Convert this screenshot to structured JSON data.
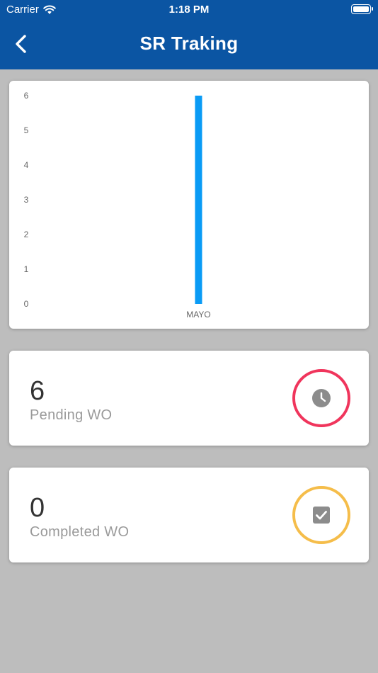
{
  "status_bar": {
    "carrier": "Carrier",
    "time": "1:18 PM"
  },
  "header": {
    "title": "SR Traking"
  },
  "colors": {
    "header_bg": "#0b55a3",
    "bar": "#0a9bf5",
    "pending_ring": "#f0355c",
    "completed_ring": "#f5bd4a",
    "icon": "#8c8c8c"
  },
  "chart_data": {
    "type": "bar",
    "categories": [
      "MAYO"
    ],
    "values": [
      6
    ],
    "ylim": [
      0,
      6
    ],
    "yticks": [
      "0",
      "1",
      "2",
      "3",
      "4",
      "5",
      "6"
    ],
    "grid": false
  },
  "stats": {
    "pending": {
      "value": "6",
      "label": "Pending WO",
      "icon": "clock-icon"
    },
    "completed": {
      "value": "0",
      "label": "Completed WO",
      "icon": "checkbox-icon"
    }
  }
}
